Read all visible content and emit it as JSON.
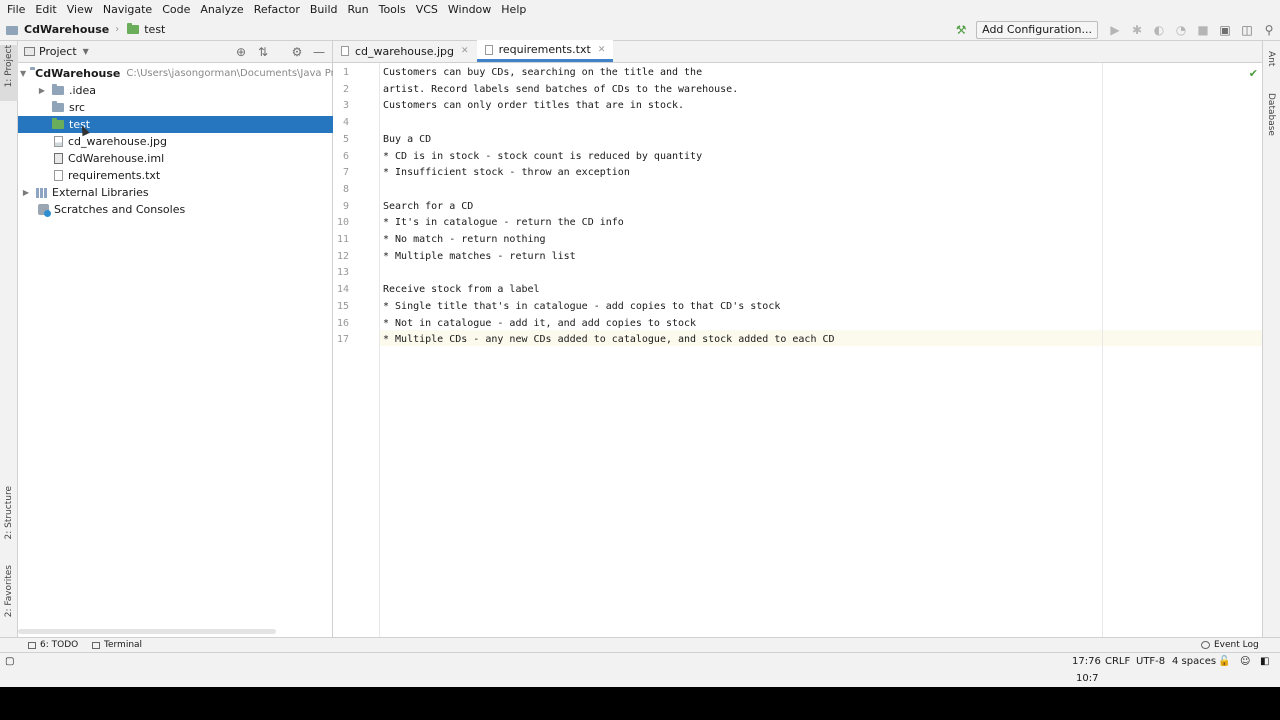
{
  "menu": [
    "File",
    "Edit",
    "View",
    "Navigate",
    "Code",
    "Analyze",
    "Refactor",
    "Build",
    "Run",
    "Tools",
    "VCS",
    "Window",
    "Help"
  ],
  "breadcrumb": {
    "project": "CdWarehouse",
    "folder": "test"
  },
  "toolbar": {
    "add_config_label": "Add Configuration..."
  },
  "left_stripe": {
    "project_tab": "1: Project",
    "structure_tab": "2: Structure",
    "favorites_tab": "2: Favorites"
  },
  "right_stripe": {
    "ant_tab": "Ant",
    "database_tab": "Database"
  },
  "project_panel": {
    "title": "Project",
    "tree": {
      "root_name": "CdWarehouse",
      "root_path": "C:\\Users\\jasongorman\\Documents\\Java Projects",
      "items": [
        ".idea",
        "src",
        "test",
        "cd_warehouse.jpg",
        "CdWarehouse.iml",
        "requirements.txt"
      ],
      "external_libraries": "External Libraries",
      "scratches": "Scratches and Consoles"
    }
  },
  "editor": {
    "tabs": [
      "cd_warehouse.jpg",
      "requirements.txt"
    ],
    "active_tab": "requirements.txt",
    "line_numbers": [
      "1",
      "2",
      "3",
      "4",
      "5",
      "6",
      "7",
      "8",
      "9",
      "10",
      "11",
      "12",
      "13",
      "14",
      "15",
      "16",
      "17"
    ],
    "lines": [
      "Customers can buy CDs, searching on the title and the",
      "artist. Record labels send batches of CDs to the warehouse.",
      "Customers can only order titles that are in stock.",
      "",
      "Buy a CD",
      "* CD is in stock - stock count is reduced by quantity",
      "* Insufficient stock - throw an exception",
      "",
      "Search for a CD",
      "* It's in catalogue - return the CD info",
      "* No match - return nothing",
      "* Multiple matches - return list",
      "",
      "Receive stock from a label",
      "* Single title that's in catalogue - add copies to that CD's stock",
      "* Not in catalogue - add it, and add copies to stock",
      "* Multiple CDs - any new CDs added to catalogue, and stock added to each CD"
    ]
  },
  "bottom_tabs": {
    "todo": "6: TODO",
    "terminal": "Terminal",
    "event_log": "Event Log"
  },
  "status": {
    "position": "17:76",
    "line_sep": "CRLF",
    "encoding": "UTF-8",
    "indent": "4 spaces",
    "time": "10:7"
  }
}
